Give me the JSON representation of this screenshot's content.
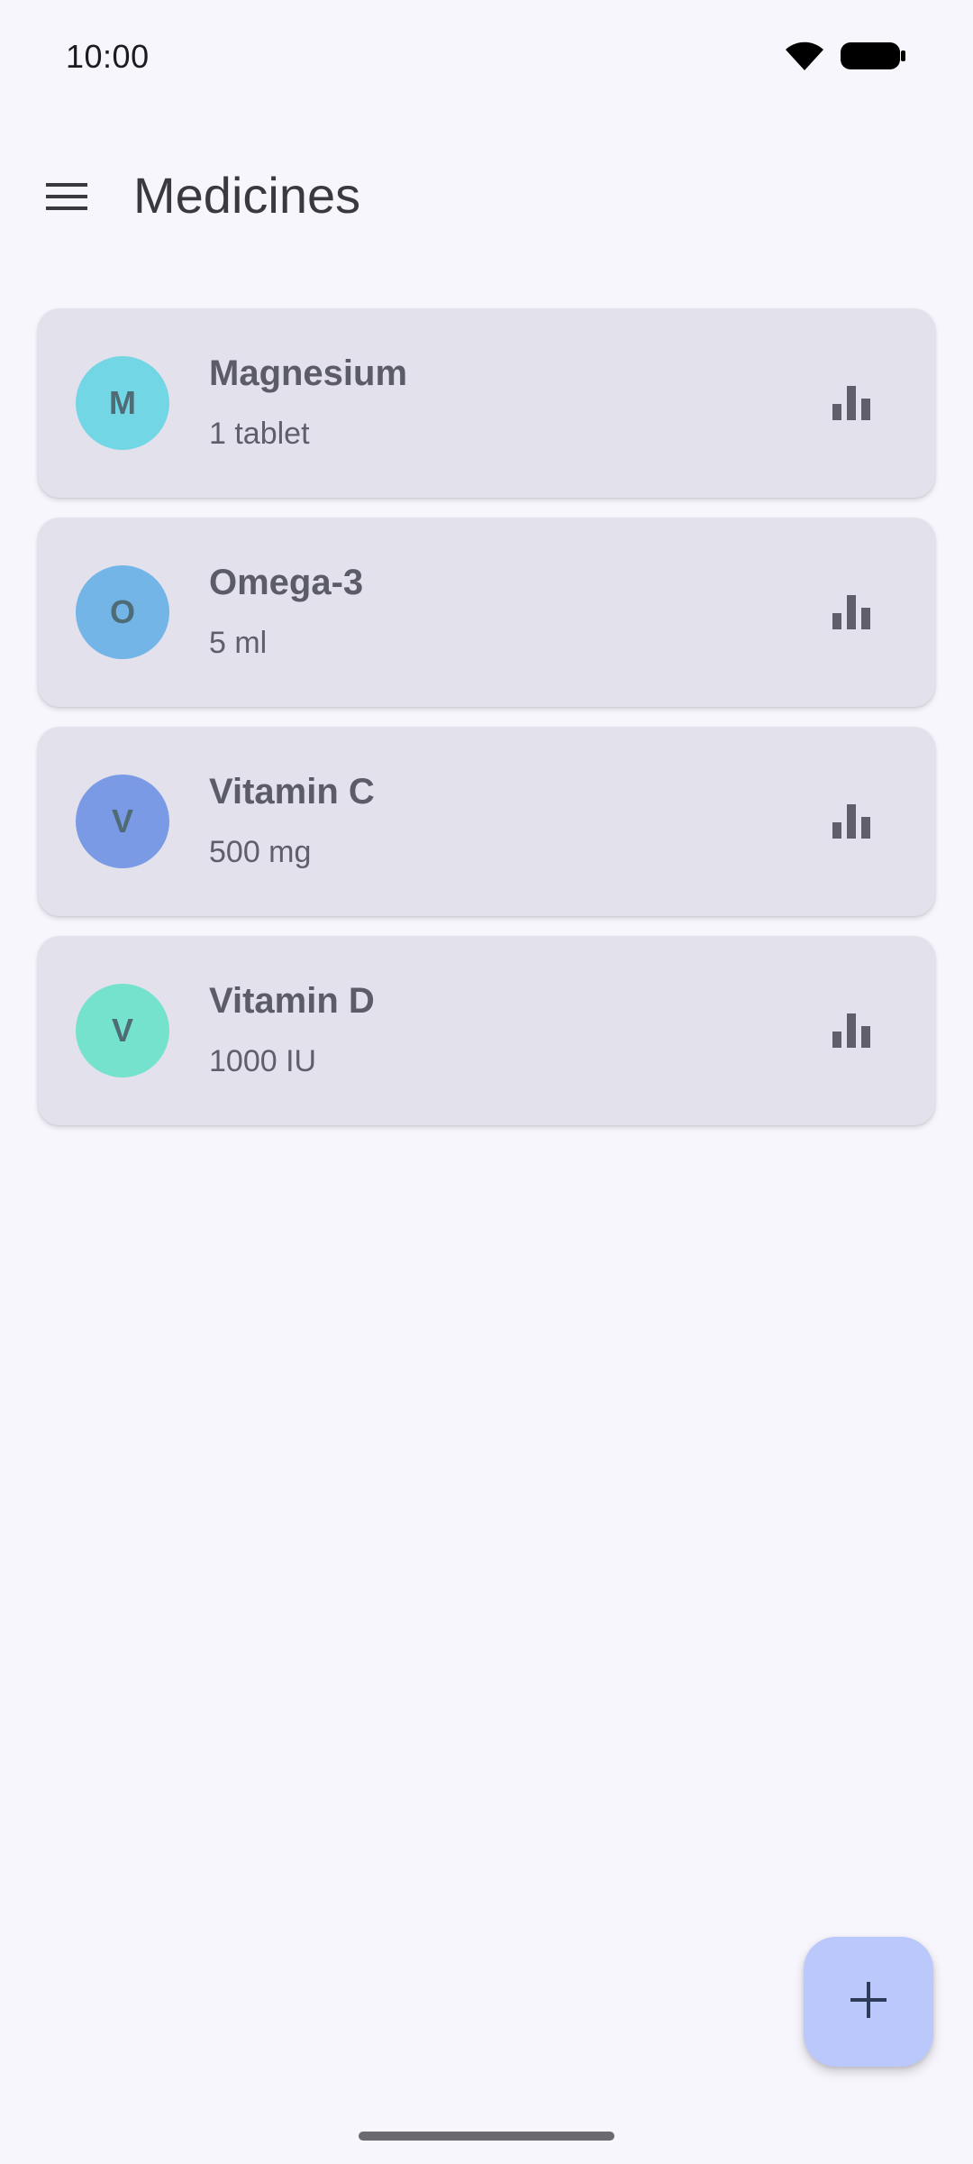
{
  "status_bar": {
    "time": "10:00",
    "icons": [
      "wifi-icon",
      "battery-icon"
    ]
  },
  "app_bar": {
    "menu_icon": "hamburger-menu-icon",
    "title": "Medicines"
  },
  "medicines": [
    {
      "initial": "M",
      "name": "Magnesium",
      "dose": "1 tablet",
      "avatar_color": "#72d6e4",
      "action_icon": "bar-chart-icon"
    },
    {
      "initial": "O",
      "name": "Omega-3",
      "dose": "5 ml",
      "avatar_color": "#73b5e7",
      "action_icon": "bar-chart-icon"
    },
    {
      "initial": "V",
      "name": "Vitamin C",
      "dose": "500 mg",
      "avatar_color": "#7b9ae6",
      "action_icon": "bar-chart-icon"
    },
    {
      "initial": "V",
      "name": "Vitamin D",
      "dose": "1000 IU",
      "avatar_color": "#74e2cc",
      "action_icon": "bar-chart-icon"
    }
  ],
  "fab": {
    "icon": "plus-icon",
    "color": "#bac8fc"
  },
  "colors": {
    "background": "#f8f6fd",
    "card": "#e2e1ec"
  }
}
